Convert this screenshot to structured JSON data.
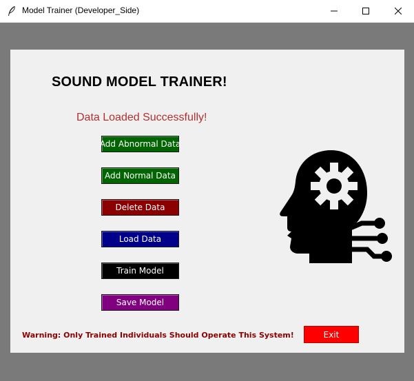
{
  "window": {
    "title": "Model Trainer (Developer_Side)",
    "icon": "feather-icon"
  },
  "main": {
    "heading": "SOUND MODEL TRAINER!",
    "status": "Data Loaded Successfully!",
    "status_color": "#b03030",
    "buttons": [
      {
        "label": "Add Abnormal Data",
        "color": "#006400"
      },
      {
        "label": "Add Normal Data",
        "color": "#006400"
      },
      {
        "label": "Delete Data",
        "color": "#8b0000"
      },
      {
        "label": "Load Data",
        "color": "#00008b"
      },
      {
        "label": "Train Model",
        "color": "#000000"
      },
      {
        "label": "Save Model",
        "color": "#800080"
      }
    ],
    "warning": "Warning: Only Trained Individuals Should Operate This System!",
    "exit_label": "Exit",
    "exit_color": "#ff0000",
    "logo_icon": "ai-head-gear-circuit-icon"
  }
}
